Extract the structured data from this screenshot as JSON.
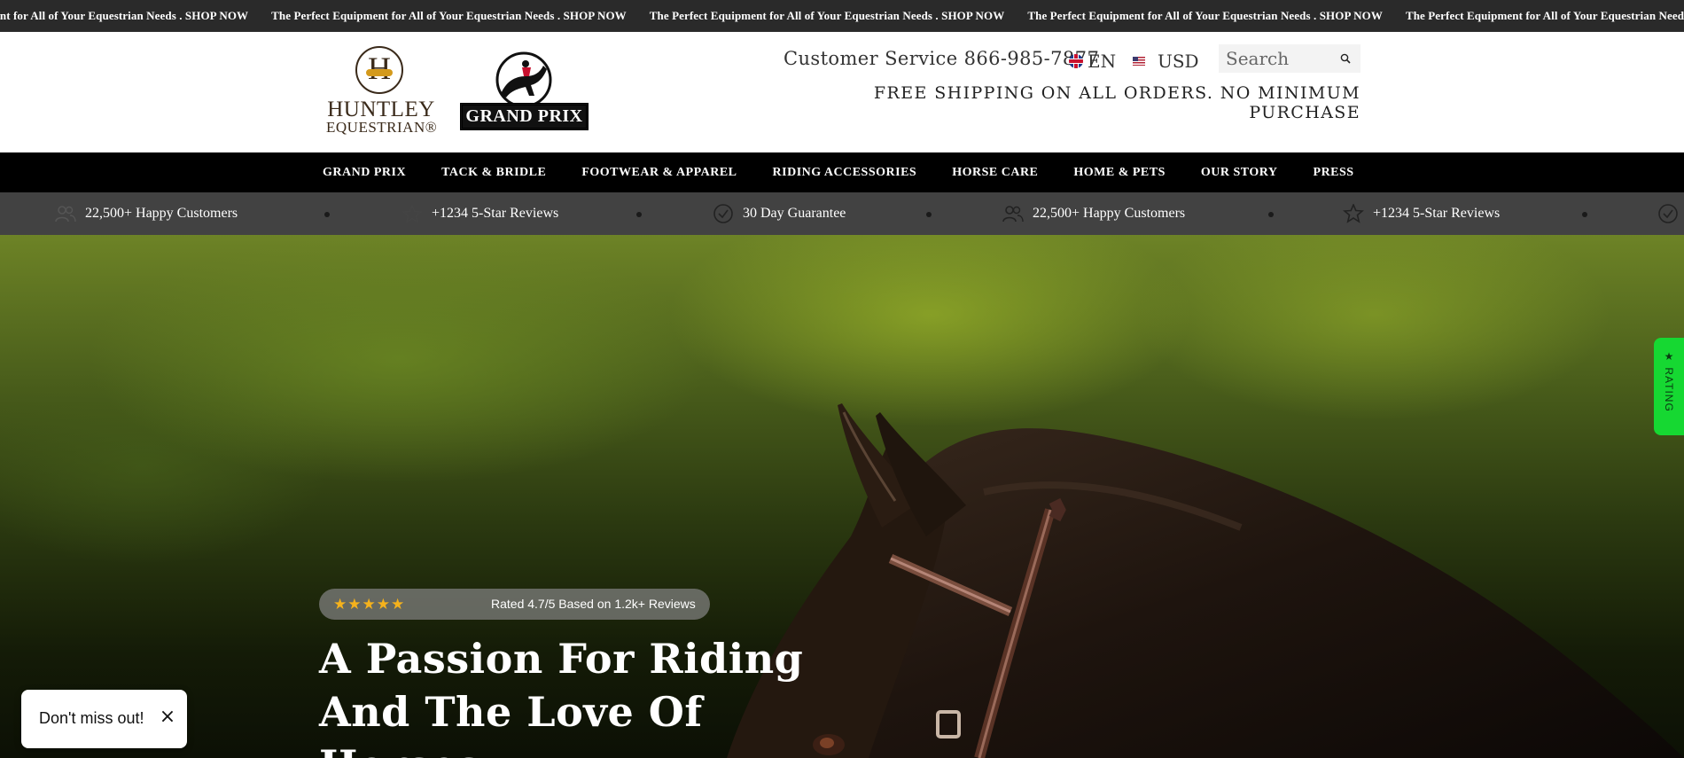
{
  "announcement": {
    "items": [
      "ent for All of Your Equestrian Needs . SHOP NOW",
      "The Perfect Equipment for All of Your Equestrian Needs . SHOP NOW",
      "The Perfect Equipment for All of Your Equestrian Needs . SHOP NOW",
      "The Perfect Equipment for All of Your Equestrian Needs . SHOP NOW",
      "The Perfect Equipment for All of Your Equestrian Needs . SHOP NOW"
    ]
  },
  "header": {
    "logo_huntley": {
      "line1": "HUNTLEY",
      "line2": "EQUESTRIAN®"
    },
    "logo_grandprix": {
      "text": "GRAND PRIX"
    },
    "customer_service": "Customer Service 866-985-7877",
    "language": "EN",
    "currency": "USD",
    "search_placeholder": "Search",
    "shipping_banner": "FREE SHIPPING ON ALL ORDERS. NO MINIMUM PURCHASE"
  },
  "nav": {
    "items": [
      "GRAND PRIX",
      "TACK & BRIDLE",
      "FOOTWEAR & APPAREL",
      "RIDING ACCESSORIES",
      "HORSE CARE",
      "HOME & PETS",
      "OUR STORY",
      "PRESS"
    ]
  },
  "trust": {
    "items": [
      "22,500+ Happy Customers",
      "+1234 5-Star Reviews",
      "30 Day Guarantee",
      "22,500+ Happy Customers",
      "+1234 5-Star Reviews"
    ]
  },
  "hero": {
    "rating_text": "Rated 4.7/5 Based on 1.2k+ Reviews",
    "stars": "★★★★★",
    "title": "A Passion For Riding And The Love Of Horses"
  },
  "side_tab": {
    "label": "★ RATING"
  },
  "popup": {
    "text": "Don't miss out!",
    "close": "×"
  },
  "colors": {
    "nav_bg": "#000000",
    "trust_bg": "#424242",
    "star": "#f5b21c",
    "side_tab": "#16d832"
  }
}
